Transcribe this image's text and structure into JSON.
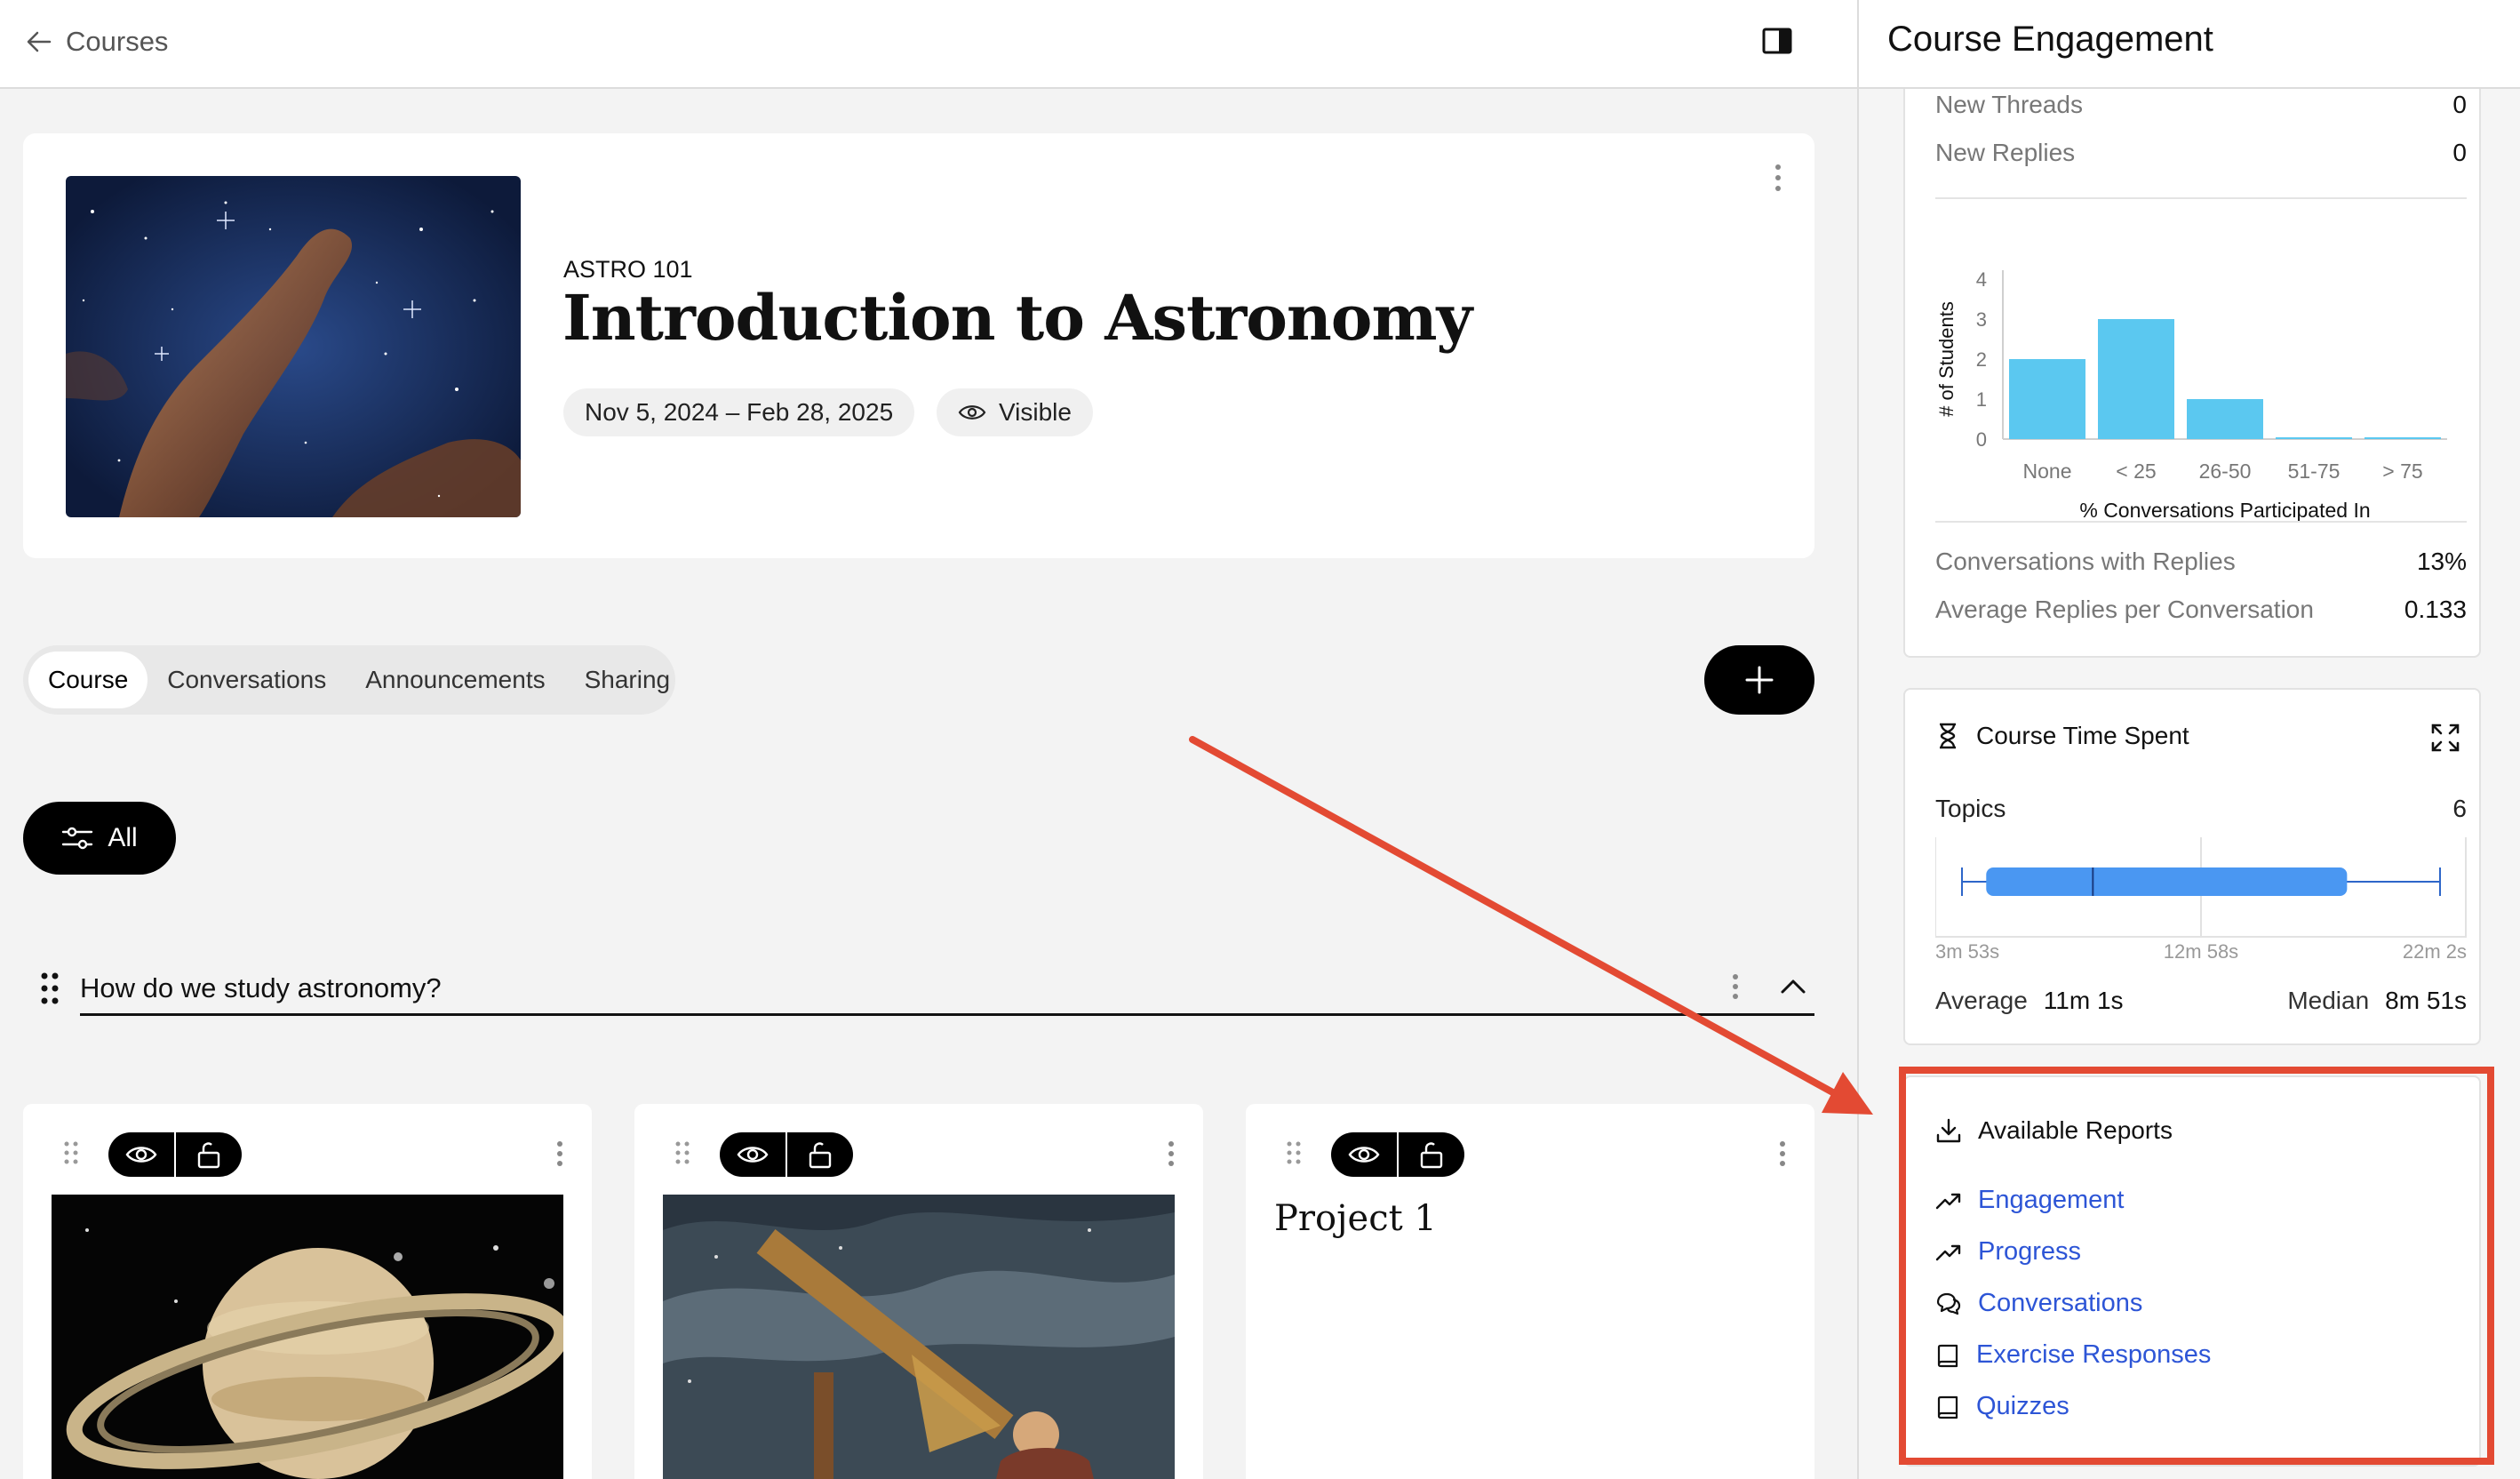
{
  "topbar": {
    "back_label": "Courses"
  },
  "course": {
    "code": "ASTRO 101",
    "title": "Introduction to Astronomy",
    "dates": "Nov 5, 2024 – Feb 28, 2025",
    "visibility": "Visible"
  },
  "tabs": [
    {
      "label": "Course",
      "active": true
    },
    {
      "label": "Conversations",
      "active": false
    },
    {
      "label": "Announcements",
      "active": false
    },
    {
      "label": "Sharing",
      "active": false
    }
  ],
  "filter": {
    "label": "All"
  },
  "section": {
    "title": "How do we study astronomy?"
  },
  "cards": [
    {
      "kind": "image",
      "image": "saturn"
    },
    {
      "kind": "image",
      "image": "telescope-astronomer"
    },
    {
      "kind": "text",
      "title": "Project 1"
    }
  ],
  "side": {
    "title": "Course Engagement",
    "stats_top": [
      {
        "label": "New Threads",
        "value": "0"
      },
      {
        "label": "New Replies",
        "value": "0"
      }
    ],
    "stats_bottom": [
      {
        "label": "Conversations with Replies",
        "value": "13%"
      },
      {
        "label": "Average Replies per Conversation",
        "value": "0.133"
      }
    ],
    "time": {
      "title": "Course Time Spent",
      "topics_label": "Topics",
      "topics_value": "6",
      "min_label": "3m 53s",
      "mid_label": "12m 58s",
      "max_label": "22m 2s",
      "average_label": "Average",
      "average_value": "11m 1s",
      "median_label": "Median",
      "median_value": "8m 51s",
      "boxplot_minutes": {
        "min": 3.88,
        "q1": 4.8,
        "median": 8.85,
        "q3": 18.5,
        "max": 22.03,
        "axis_min": 3.88,
        "axis_max": 22.03
      }
    },
    "reports": {
      "title": "Available Reports",
      "items": [
        {
          "label": "Engagement",
          "icon": "trend-up-icon"
        },
        {
          "label": "Progress",
          "icon": "trend-up-icon"
        },
        {
          "label": "Conversations",
          "icon": "chat-bubbles-icon"
        },
        {
          "label": "Exercise Responses",
          "icon": "book-icon"
        },
        {
          "label": "Quizzes",
          "icon": "book-icon"
        }
      ]
    }
  },
  "colors": {
    "bar": "#5bc8f0",
    "boxplot": "#4a97f2",
    "link": "#2d55d6",
    "highlight": "#e34a33"
  },
  "chart_data": {
    "type": "bar",
    "categories": [
      "None",
      "< 25",
      "26-50",
      "51-75",
      "> 75"
    ],
    "values": [
      2,
      3,
      1,
      0,
      0
    ],
    "xlabel": "% Conversations Participated In",
    "ylabel": "# of Students",
    "yticks": [
      "0",
      "1",
      "2",
      "3",
      "4"
    ],
    "ylim": [
      0,
      4
    ]
  }
}
